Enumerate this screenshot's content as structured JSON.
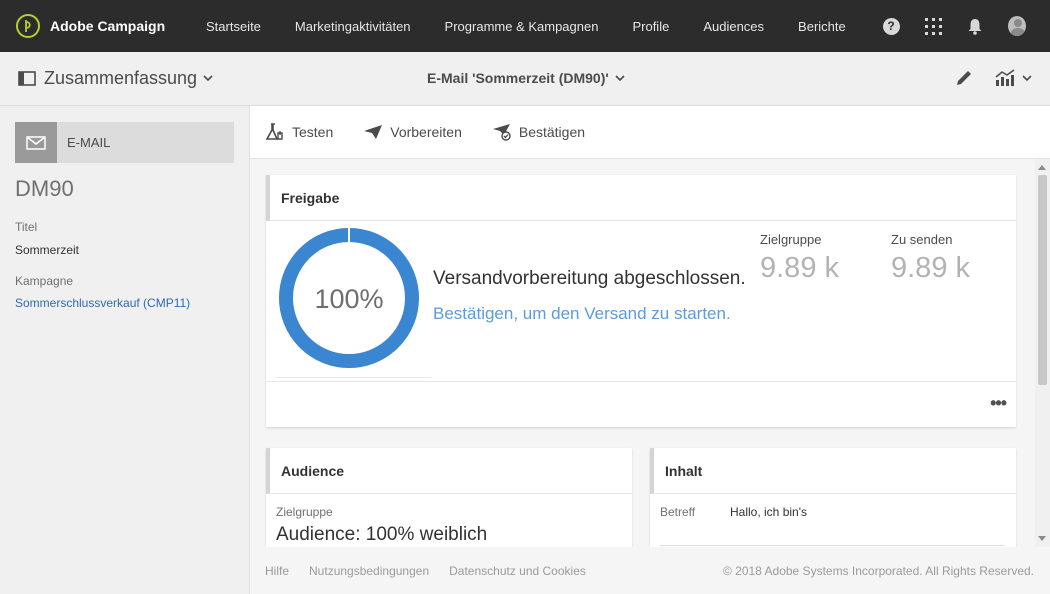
{
  "app": {
    "title": "Adobe Campaign"
  },
  "nav": {
    "items": [
      "Startseite",
      "Marketingaktivitäten",
      "Programme & Kampagnen",
      "Profile",
      "Audiences",
      "Berichte"
    ]
  },
  "subheader": {
    "summary_label": "Zusammenfassung",
    "email_title": "E-Mail 'Sommerzeit (DM90)'"
  },
  "sidebar": {
    "badge_label": "E-MAIL",
    "code": "DM90",
    "title_label": "Titel",
    "title_value": "Sommerzeit",
    "campaign_label": "Kampagne",
    "campaign_value": "Sommerschlussverkauf (CMP11)"
  },
  "toolbar": {
    "test_label": "Testen",
    "prepare_label": "Vorbereiten",
    "confirm_label": "Bestätigen"
  },
  "approval": {
    "header": "Freigabe",
    "percent_text": "100%",
    "progress": 1.0,
    "status": "Versandvorbereitung abgeschlossen.",
    "action_link": "Bestätigen, um den Versand zu starten.",
    "target_label": "Zielgruppe",
    "target_value": "9.89 k",
    "to_send_label": "Zu senden",
    "to_send_value": "9.89 k",
    "more_label": "•••"
  },
  "audience": {
    "header": "Audience",
    "target_label": "Zielgruppe",
    "target_value": "Audience: 100% weiblich"
  },
  "content_card": {
    "header": "Inhalt",
    "subject_label": "Betreff",
    "subject_value": "Hallo, ich bin's"
  },
  "footer": {
    "help": "Hilfe",
    "terms": "Nutzungsbedingungen",
    "privacy": "Datenschutz und Cookies",
    "copyright": "© 2018 Adobe Systems Incorporated. All Rights Reserved."
  },
  "colors": {
    "accent_blue": "#3b86d0",
    "link_blue": "#5b9be0",
    "topbar": "#2c2c2c",
    "logo_green": "#b5d12e"
  }
}
